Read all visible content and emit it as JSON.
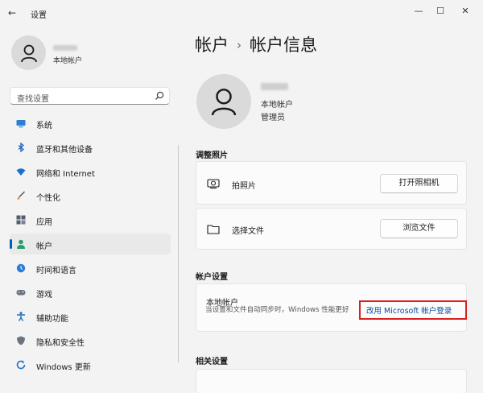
{
  "window": {
    "title": "设置",
    "back_icon": "back-arrow-icon",
    "minimize": "—",
    "maximize": "☐",
    "close": "✕"
  },
  "sidebar": {
    "user_type": "本地帐户",
    "search_placeholder": "查找设置",
    "items": [
      {
        "label": "系统",
        "icon": "monitor-icon",
        "color": "#2d7fd6"
      },
      {
        "label": "蓝牙和其他设备",
        "icon": "bluetooth-icon",
        "color": "#2563c0"
      },
      {
        "label": "网络和 Internet",
        "icon": "wifi-icon",
        "color": "#1c6fd1"
      },
      {
        "label": "个性化",
        "icon": "brush-icon",
        "color": "#e3a13a"
      },
      {
        "label": "应用",
        "icon": "apps-icon",
        "color": "#555e6c"
      },
      {
        "label": "帐户",
        "icon": "person-icon",
        "color": "#27a06a",
        "active": true
      },
      {
        "label": "时间和语言",
        "icon": "globe-clock-icon",
        "color": "#2b7bd8"
      },
      {
        "label": "游戏",
        "icon": "gamepad-icon",
        "color": "#6b7280"
      },
      {
        "label": "辅助功能",
        "icon": "accessibility-icon",
        "color": "#1f6fbf"
      },
      {
        "label": "隐私和安全性",
        "icon": "shield-icon",
        "color": "#6b7280"
      },
      {
        "label": "Windows 更新",
        "icon": "update-icon",
        "color": "#1a73d0"
      }
    ]
  },
  "main": {
    "breadcrumb": {
      "parent": "帐户",
      "separator": "›",
      "current": "帐户信息"
    },
    "profile": {
      "type": "本地帐户",
      "role": "管理员"
    },
    "photo_section": {
      "title": "调整照片",
      "take_photo": {
        "label": "拍照片",
        "button": "打开照相机"
      },
      "choose_file": {
        "label": "选择文件",
        "button": "浏览文件"
      }
    },
    "account_section": {
      "title": "帐户设置",
      "local_account_title": "本地帐户",
      "description": "当设置和文件自动同步时，Windows 性能更好",
      "link": "改用 Microsoft 帐户登录"
    },
    "related_section": {
      "title": "相关设置"
    }
  },
  "colors": {
    "accent": "#005fb8",
    "link": "#0a4a9c",
    "highlight_box": "#d82020"
  }
}
